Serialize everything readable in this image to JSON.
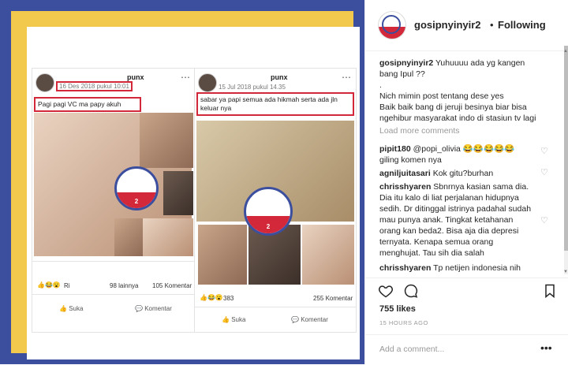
{
  "header": {
    "username": "gosipnyinyir2",
    "separator": "•",
    "follow_status": "Following"
  },
  "caption": {
    "username": "gosipnyinyir2",
    "line1": "Yuhuuuu ada yg kangen bang Ipul ??",
    "line2": ".",
    "line3": "Nich mimin post tentang dese yes",
    "line4": "Baik baik bang di jeruji besinya biar bisa ngehibur masyarakat indo di stasiun tv lagi"
  },
  "load_more": "Load more comments",
  "comments": [
    {
      "user": "pipit180",
      "text": "@popi_olivia 😂😂😂😂😂 giling komen nya"
    },
    {
      "user": "agniljuitasari",
      "text": "Kok gitu?burhan"
    },
    {
      "user": "chrisshyaren",
      "text": "Sbnrnya kasian sama dia. Dia itu kalo di liat perjalanan hidupnya sedih. Dr ditinggal istrinya padahal sudah mau punya anak. Tingkat ketahanan orang kan beda2. Bisa aja dia depresi ternyata. Kenapa semua orang menghujat. Tau sih dia salah"
    },
    {
      "user": "chrisshyaren",
      "text": "Tp netijen indonesia nih"
    }
  ],
  "likes": "755 likes",
  "timestamp": "15 HOURS AGO",
  "add_comment_placeholder": "Add a comment...",
  "post_left": {
    "name": "punx",
    "date": "16 Des 2018 pukul 10:01",
    "text": "Pagi pagi VC ma papy akuh",
    "reactions_name": "Ri",
    "reactions_count": "98 lainnya",
    "comments_count": "105 Komentar",
    "like_label": "Suka",
    "comment_label": "Komentar"
  },
  "post_right": {
    "name": "punx",
    "date": "15 Jul 2018 pukul 14.35",
    "text": "sabar ya papi semua ada hikmah serta ada jln keluar nya",
    "reactions_count": "383",
    "comments_count": "255 Komentar",
    "like_label": "Suka",
    "comment_label": "Komentar"
  },
  "logo_number": "2",
  "icons": [
    "heart-icon",
    "comment-icon",
    "bookmark-icon",
    "more-icon"
  ],
  "colors": {
    "frame_blue": "#3c4f9e",
    "frame_yellow": "#f2c94c",
    "highlight_red": "#d2283a"
  }
}
